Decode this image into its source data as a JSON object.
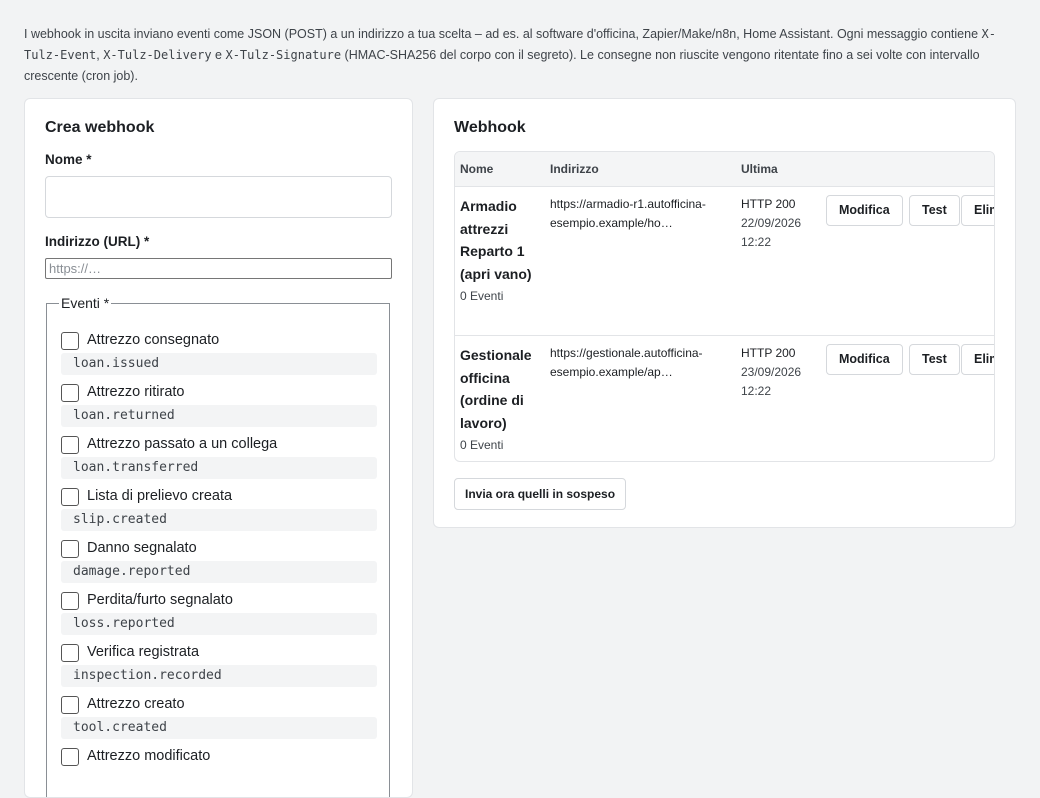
{
  "intro": {
    "text_1": "I webhook in uscita inviano eventi come JSON (POST) a un indirizzo a tua scelta – ad es. al software d'officina, Zapier/Make/n8n, Home Assistant. Ogni messaggio contiene ",
    "header_event": "X-Tulz-Event",
    "sep_1": ", ",
    "header_delivery": "X-Tulz-Delivery",
    "sep_2": " e ",
    "header_signature": "X-Tulz-Signature",
    "text_2": " (HMAC-SHA256 del corpo con il segreto). Le consegne non riuscite vengono ritentate fino a sei volte con intervallo crescente (cron job)."
  },
  "create_form": {
    "title": "Crea webhook",
    "name_label": "Nome *",
    "name_value": "",
    "url_label": "Indirizzo (URL) *",
    "url_placeholder": "https://…",
    "url_value": "",
    "events_legend": "Eventi *",
    "events": [
      {
        "label": "Attrezzo consegnato",
        "code": "loan.issued",
        "checked": false
      },
      {
        "label": "Attrezzo ritirato",
        "code": "loan.returned",
        "checked": false
      },
      {
        "label": "Attrezzo passato a un collega",
        "code": "loan.transferred",
        "checked": false
      },
      {
        "label": "Lista di prelievo creata",
        "code": "slip.created",
        "checked": false
      },
      {
        "label": "Danno segnalato",
        "code": "damage.reported",
        "checked": false
      },
      {
        "label": "Perdita/furto segnalato",
        "code": "loss.reported",
        "checked": false
      },
      {
        "label": "Verifica registrata",
        "code": "inspection.recorded",
        "checked": false
      },
      {
        "label": "Attrezzo creato",
        "code": "tool.created",
        "checked": false
      },
      {
        "label": "Attrezzo modificato",
        "code": "",
        "checked": false
      }
    ]
  },
  "webhooks": {
    "title": "Webhook",
    "columns": {
      "name": "Nome",
      "url": "Indirizzo",
      "last": "Ultima"
    },
    "rows": [
      {
        "name": "Armadio attrezzi Reparto 1 (apri vano)",
        "events_count": "0 Eventi",
        "url": "https://armadio-r1.autofficina-esempio.example/ho…",
        "last_status": "HTTP 200",
        "last_date": "22/09/2026 12:22",
        "edit_label": "Modifica",
        "test_label": "Test",
        "delete_label": "Elimina"
      },
      {
        "name": "Gestionale officina (ordine di lavoro)",
        "events_count": "0 Eventi",
        "url": "https://gestionale.autofficina-esempio.example/ap…",
        "last_status": "HTTP 200",
        "last_date": "23/09/2026 12:22",
        "edit_label": "Modifica",
        "test_label": "Test",
        "delete_label": "Elimina"
      }
    ],
    "send_pending_label": "Invia ora quelli in sospeso"
  }
}
